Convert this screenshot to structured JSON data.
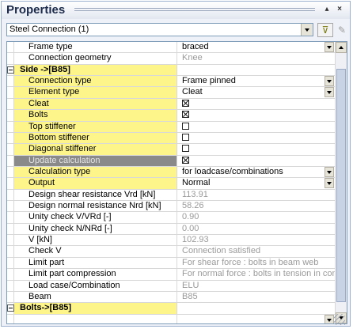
{
  "panel": {
    "title": "Properties",
    "pin_label": "▴",
    "close_label": "×",
    "selector_value": "Steel Connection (1)",
    "filter_icon": "funnel-icon",
    "edit_icon": "pencil-icon"
  },
  "rows": [
    {
      "name": "Frame type",
      "value": "braced",
      "kind": "normal",
      "dropdown": true
    },
    {
      "name": "Connection geometry",
      "value": "Knee",
      "kind": "readonly"
    },
    {
      "name": "Side ->[B85]",
      "value": "",
      "kind": "section"
    },
    {
      "name": "Connection type",
      "value": "Frame pinned",
      "kind": "yellow",
      "dropdown": true
    },
    {
      "name": "Element type",
      "value": "Cleat",
      "kind": "yellow",
      "dropdown": true
    },
    {
      "name": "Cleat",
      "value": "",
      "kind": "yellow",
      "checkbox": true
    },
    {
      "name": "Bolts",
      "value": "",
      "kind": "yellow",
      "checkbox": true
    },
    {
      "name": "Top stiffener",
      "value": "",
      "kind": "yellow",
      "checkbox": false
    },
    {
      "name": "Bottom stiffener",
      "value": "",
      "kind": "yellow",
      "checkbox": false
    },
    {
      "name": "Diagonal stiffener",
      "value": "",
      "kind": "yellow",
      "checkbox": false
    },
    {
      "name": "Update calculation",
      "value": "",
      "kind": "active",
      "checkbox": true
    },
    {
      "name": "Calculation type",
      "value": "for loadcase/combinations",
      "kind": "yellow",
      "dropdown": true
    },
    {
      "name": "Output",
      "value": "Normal",
      "kind": "yellow",
      "dropdown": true
    },
    {
      "name": "Design shear resistance Vrd [kN]",
      "value": "113.91",
      "kind": "readonly"
    },
    {
      "name": "Design normal resistance Nrd [kN]",
      "value": "58.26",
      "kind": "readonly"
    },
    {
      "name": "Unity check V/VRd [-]",
      "value": "0.90",
      "kind": "readonly"
    },
    {
      "name": "Unity check N/NRd [-]",
      "value": "0.00",
      "kind": "readonly"
    },
    {
      "name": "V [kN]",
      "value": "102.93",
      "kind": "readonly"
    },
    {
      "name": "Check V",
      "value": "Connection satisfied",
      "kind": "readonly"
    },
    {
      "name": "Limit part",
      "value": "For shear force : bolts in beam web",
      "kind": "readonly"
    },
    {
      "name": "Limit part compression",
      "value": "For normal force : bolts in tension in connecti...",
      "kind": "readonly"
    },
    {
      "name": "Load case/Combination",
      "value": "ELU",
      "kind": "readonly"
    },
    {
      "name": "Beam",
      "value": "B85",
      "kind": "readonly"
    },
    {
      "name": "Bolts->[B85]",
      "value": "",
      "kind": "section"
    },
    {
      "name": "",
      "value": "",
      "kind": "normal",
      "dropdown": true
    }
  ],
  "scrollbar": {
    "thumb_start": 0.06,
    "thumb_size": 0.9
  }
}
